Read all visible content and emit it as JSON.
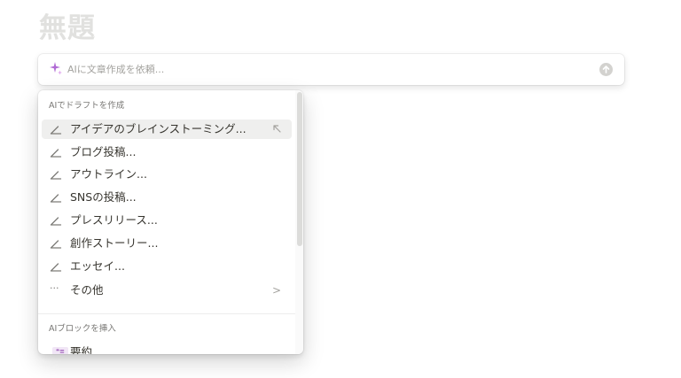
{
  "page": {
    "title": "無題"
  },
  "ai_input": {
    "placeholder": "AIに文章作成を依頼...",
    "value": "",
    "accent_color": "#a855c8"
  },
  "menu": {
    "draft_section": {
      "header": "AIでドラフトを作成",
      "items": [
        {
          "label": "アイデアのブレインストーミング...",
          "icon": "pencil-icon",
          "hovered": true,
          "hint_icon": "arrow-up-left-icon"
        },
        {
          "label": "ブログ投稿...",
          "icon": "pencil-icon"
        },
        {
          "label": "アウトライン...",
          "icon": "pencil-icon"
        },
        {
          "label": "SNSの投稿...",
          "icon": "pencil-icon"
        },
        {
          "label": "プレスリリース...",
          "icon": "pencil-icon"
        },
        {
          "label": "創作ストーリー...",
          "icon": "pencil-icon"
        },
        {
          "label": "エッセイ...",
          "icon": "pencil-icon"
        },
        {
          "label": "その他",
          "icon": "more-dots-icon",
          "chevron": ">"
        }
      ]
    },
    "block_section": {
      "header": "AIブロックを挿入",
      "items": [
        {
          "label": "要約",
          "icon": "quote-block-icon",
          "icon_text": "❝≡"
        }
      ]
    }
  }
}
